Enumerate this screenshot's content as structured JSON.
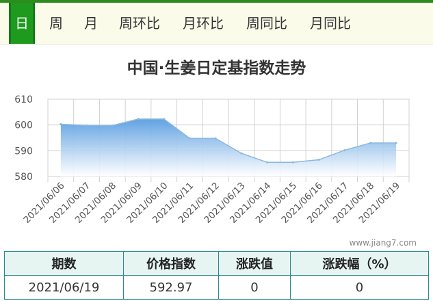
{
  "tabs": [
    "日",
    "周",
    "月",
    "周环比",
    "月环比",
    "周同比",
    "月同比"
  ],
  "active_tab": "日",
  "watermark": "www.jiang7.com",
  "colors": {
    "brand_green": "#1e9a1e",
    "line": "#8ab8e0",
    "area_top": "#5a9ee0",
    "table_border": "#2a8a8a",
    "table_header_bg": "#e6f5f2"
  },
  "chart_data": {
    "type": "area",
    "title": "中国·生姜日定基指数走势",
    "x": [
      "2021/06/06",
      "2021/06/07",
      "2021/06/08",
      "2021/06/09",
      "2021/06/10",
      "2021/06/11",
      "2021/06/12",
      "2021/06/13",
      "2021/06/14",
      "2021/06/15",
      "2021/06/16",
      "2021/06/17",
      "2021/06/18",
      "2021/06/19"
    ],
    "y": [
      600.3,
      599.8,
      599.8,
      602.3,
      602.3,
      594.8,
      594.8,
      589.0,
      585.5,
      585.5,
      586.5,
      590.2,
      593.0,
      593.0
    ],
    "yticks": [
      580,
      590,
      600,
      610
    ],
    "ylim": [
      580,
      610
    ],
    "grid": true,
    "xlabel": "",
    "ylabel": ""
  },
  "summary": {
    "headers": [
      "期数",
      "价格指数",
      "涨跌值",
      "涨跌幅（%）"
    ],
    "row": [
      "2021/06/19",
      "592.97",
      "0",
      "0"
    ]
  }
}
